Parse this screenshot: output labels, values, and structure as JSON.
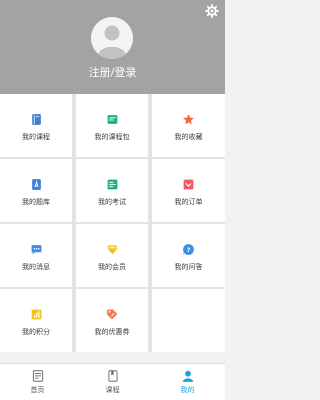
{
  "header": {
    "login_label": "注册/登录"
  },
  "menu": [
    {
      "label": "我的课程",
      "icon": "book-icon",
      "color": "#3d7fd6"
    },
    {
      "label": "我的课程包",
      "icon": "course-package-icon",
      "color": "#20b07a"
    },
    {
      "label": "我的收藏",
      "icon": "star-icon",
      "color": "#f26a3d"
    },
    {
      "label": "我的题库",
      "icon": "question-bank-icon",
      "color": "#3d7fd6"
    },
    {
      "label": "我的考试",
      "icon": "exam-icon",
      "color": "#20b07a"
    },
    {
      "label": "我的订单",
      "icon": "order-icon",
      "color": "#f05a6a"
    },
    {
      "label": "我的消息",
      "icon": "message-icon",
      "color": "#3d8ee0"
    },
    {
      "label": "我的会员",
      "icon": "vip-diamond-icon",
      "color": "#f2c21b"
    },
    {
      "label": "我的问答",
      "icon": "qa-icon",
      "color": "#3d8ee0"
    },
    {
      "label": "我的积分",
      "icon": "points-icon",
      "color": "#f2c21b"
    },
    {
      "label": "我的优惠券",
      "icon": "coupon-icon",
      "color": "#f07a4a"
    }
  ],
  "tabs": [
    {
      "label": "首页",
      "icon": "home-icon"
    },
    {
      "label": "课程",
      "icon": "course-icon"
    },
    {
      "label": "我的",
      "icon": "profile-icon",
      "active": true
    }
  ],
  "colors": {
    "header_bg": "#a3a3a3",
    "active_tab": "#1aa3e8"
  }
}
